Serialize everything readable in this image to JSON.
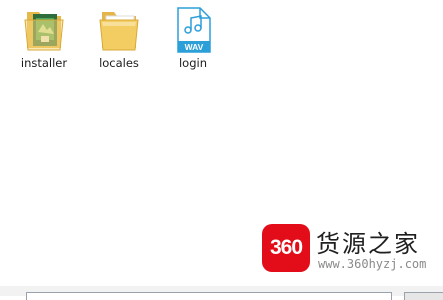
{
  "files": [
    {
      "name": "installer",
      "icon": "folder-with-document-icon"
    },
    {
      "name": "locales",
      "icon": "folder-icon"
    },
    {
      "name": "login",
      "icon": "wav-audio-file-icon",
      "badge": "WAV"
    }
  ],
  "watermark": {
    "logo_text": "360",
    "site_name": "货源之家",
    "url": "www.360hyzj.com",
    "logo_color": "#e20d18"
  },
  "colors": {
    "folder_yellow": "#f3cd62",
    "wav_blue": "#2a9fd8"
  }
}
